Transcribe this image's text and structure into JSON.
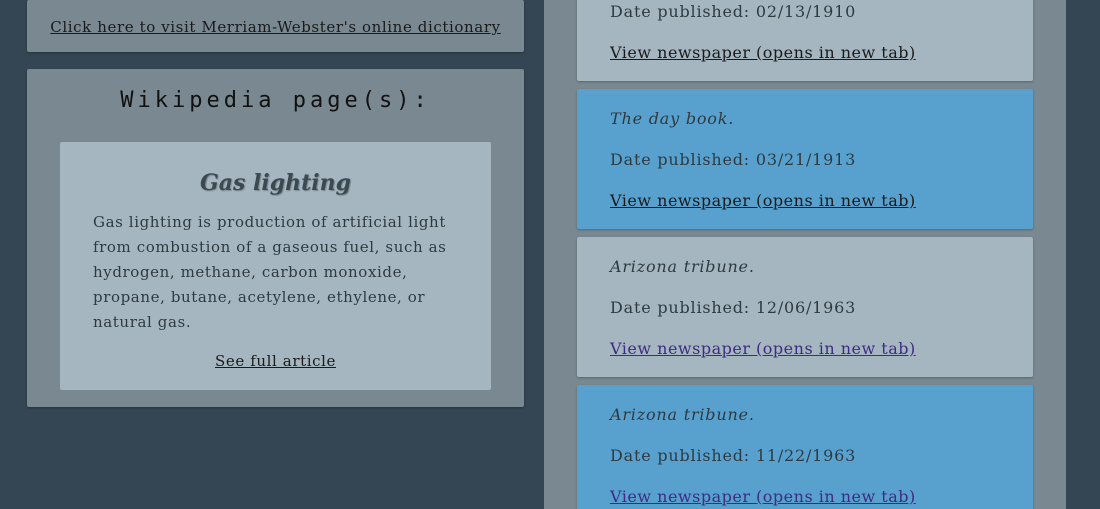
{
  "merriam_webster": {
    "link_text": "Click here to visit Merriam-Webster's online dictionary"
  },
  "wikipedia": {
    "heading": "Wikipedia page(s):",
    "title": "Gas lighting",
    "summary": "Gas lighting is production of artificial light from combustion of a gaseous fuel, such as hydrogen, methane, carbon monoxide, propane, butane, acetylene, ethylene, or natural gas.",
    "full_article_link": "See full article"
  },
  "newspapers": [
    {
      "name": "",
      "date": "Date published: 02/13/1910",
      "link": "View newspaper (opens in new tab)",
      "color": "#a6b6c0"
    },
    {
      "name": "The day book.",
      "date": "Date published: 03/21/1913",
      "link": "View newspaper (opens in new tab)",
      "color": "#58a1cf"
    },
    {
      "name": "Arizona tribune.",
      "date": "Date published: 12/06/1963",
      "link": "View newspaper (opens in new tab)",
      "color": "#a6b6c0"
    },
    {
      "name": "Arizona tribune.",
      "date": "Date published: 11/22/1963",
      "link": "View newspaper (opens in new tab)",
      "color": "#58a1cf"
    }
  ],
  "colors": {
    "background": "#344653",
    "panel": "#798891",
    "card_grey": "#a6b6c0",
    "card_blue": "#58a1cf",
    "visited_link": "#3e2b83"
  }
}
